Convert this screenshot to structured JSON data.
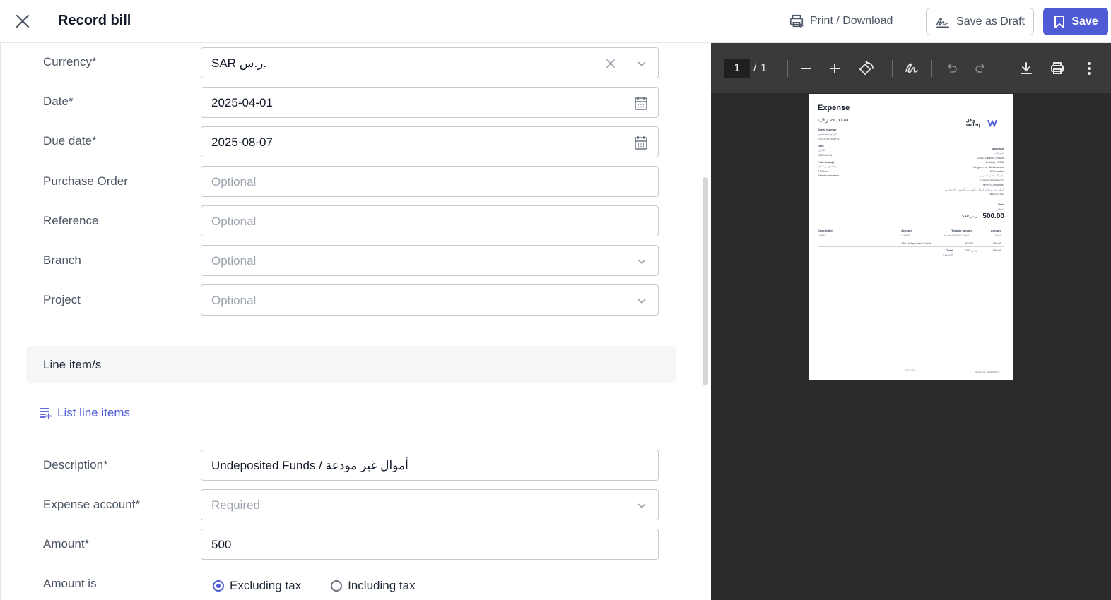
{
  "header": {
    "title": "Record bill",
    "print_label": "Print / Download",
    "draft_label": "Save as Draft",
    "save_label": "Save"
  },
  "form": {
    "currency": {
      "label": "Currency*",
      "value": "SAR ر.س."
    },
    "date": {
      "label": "Date*",
      "value": "2025-04-01"
    },
    "due_date": {
      "label": "Due date*",
      "value": "2025-08-07"
    },
    "purchase_order": {
      "label": "Purchase Order",
      "placeholder": "Optional"
    },
    "reference": {
      "label": "Reference",
      "placeholder": "Optional"
    },
    "branch": {
      "label": "Branch",
      "placeholder": "Optional"
    },
    "project": {
      "label": "Project",
      "placeholder": "Optional"
    }
  },
  "line_items": {
    "section_title": "Line item/s",
    "list_link": "List line items",
    "description": {
      "label": "Description*",
      "value": "Undeposited Funds / أموال غير مودعة"
    },
    "expense_account": {
      "label": "Expense account*",
      "placeholder": "Required"
    },
    "amount": {
      "label": "Amount*",
      "value": "500"
    },
    "amount_is": {
      "label": "Amount is",
      "options": [
        "Excluding tax",
        "Including tax"
      ],
      "selected": "Excluding tax"
    }
  },
  "viewer": {
    "current_page": "1",
    "separator": "/",
    "total_pages": "1"
  },
  "document": {
    "title": "Expense",
    "title_ar": "سند صرف",
    "logo_text": "wafeq",
    "logo_text_ar": "وافق",
    "serial_label": "Serial number",
    "serial_label_ar": "الرقم التسلسلي",
    "serial_value": "SYS-CSH-EXP-1",
    "date_label": "Date",
    "date_label_ar": "التاريخ",
    "date_value": "2025-04-01",
    "paid_label": "Paid through",
    "paid_label_ar": "تم الدفع من خلال",
    "paid_value_1": "210 Visa",
    "paid_value_2": "Reimbursements",
    "company": "Ashrakat",
    "company_ar": "اشراقات",
    "address_1": "2346, Zahran, Rawda",
    "address_2": "Jeddah, 23283",
    "address_3": "Kingdom of Saudi Arabia",
    "vat_label": "VAT number",
    "vat_label_ar": "رقم التسجيل الضريبي",
    "vat_value": "3473945378980903",
    "cr_label": "MHRSD Number",
    "cr_label_ar": "الرقم لدى وزارة الموارد البشرية والتنمية الاجتماعية",
    "cr_value": "7832223367",
    "total_label": "Total",
    "total_label_ar": "المبلغ",
    "total_currency": "SAR ر.س.",
    "total_value": "500.00",
    "col_description": "Description",
    "col_description_ar": "الوصف",
    "col_account": "Account",
    "col_account_ar": "الحساب",
    "col_taxable": "Taxable amount",
    "col_taxable_ar": "المبلغ الخاضع للضريبة",
    "col_amount": "Amount",
    "col_amount_ar": "المبلغ",
    "row_account": "130 Undeposited Funds",
    "row_taxable": "500.00",
    "row_amount": "500.00",
    "foot_total": "Total",
    "foot_total_ar": "المجموع",
    "foot_currency": "SAR ر.س.",
    "foot_amount": "500.00",
    "footer_note": "Generated",
    "footer_page": "Page 1 of 1 · CSH-EXP-1"
  },
  "colors": {
    "accent": "#4f5bd5",
    "viewer_bg": "#2b2b2b",
    "viewer_toolbar": "#3a3a3a"
  }
}
